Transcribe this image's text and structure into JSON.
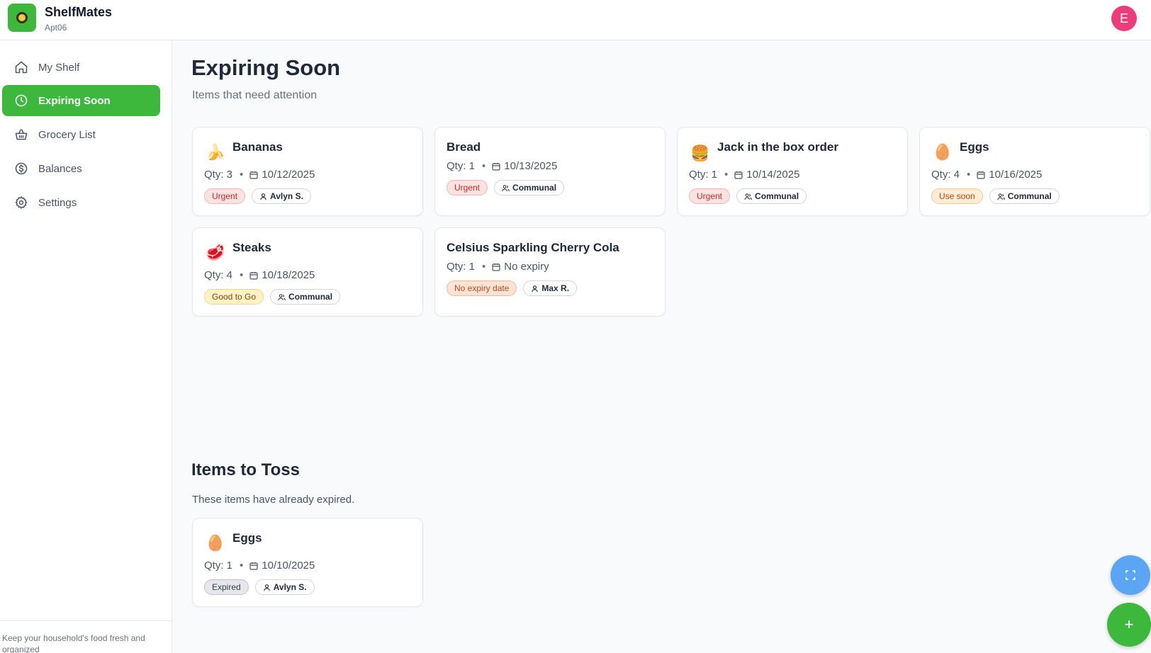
{
  "app": {
    "name": "ShelfMates",
    "household": "Apt06",
    "avatar_letter": "E",
    "avatar_color": "#ec3d7a",
    "accent": "#3db83d"
  },
  "sidebar": {
    "items": [
      {
        "label": "My Shelf",
        "icon": "home-icon",
        "active": false
      },
      {
        "label": "Expiring Soon",
        "icon": "clock-icon",
        "active": true
      },
      {
        "label": "Grocery List",
        "icon": "basket-icon",
        "active": false
      },
      {
        "label": "Balances",
        "icon": "dollar-circle-icon",
        "active": false
      },
      {
        "label": "Settings",
        "icon": "gear-icon",
        "active": false
      }
    ],
    "footer": "Keep your household's food fresh and organized"
  },
  "main": {
    "title": "Expiring Soon",
    "subtitle": "Items that need attention",
    "cards": [
      {
        "name": "Bananas",
        "emoji": "🍌",
        "qty": "Qty: 3",
        "date": "10/12/2025",
        "status": "Urgent",
        "owner": "Avlyn S.",
        "owner_type": "person"
      },
      {
        "name": "Bread",
        "emoji": "",
        "qty": "Qty: 1",
        "date": "10/13/2025",
        "status": "Urgent",
        "owner": "Communal",
        "owner_type": "group"
      },
      {
        "name": "Jack in the box order",
        "emoji": "🍔",
        "qty": "Qty: 1",
        "date": "10/14/2025",
        "status": "Urgent",
        "owner": "Communal",
        "owner_type": "group"
      },
      {
        "name": "Eggs",
        "emoji": "🥚",
        "qty": "Qty: 4",
        "date": "10/16/2025",
        "status": "Use soon",
        "owner": "Communal",
        "owner_type": "group"
      },
      {
        "name": "Steaks",
        "emoji": "🥩",
        "qty": "Qty: 4",
        "date": "10/18/2025",
        "status": "Good to Go",
        "owner": "Communal",
        "owner_type": "group"
      },
      {
        "name": "Celsius Sparkling Cherry Cola",
        "emoji": "",
        "qty": "Qty: 1",
        "date": "No expiry",
        "status": "No expiry date",
        "owner": "Max R.",
        "owner_type": "person"
      }
    ]
  },
  "toss": {
    "title": "Items to Toss",
    "subtitle": "These items have already expired.",
    "cards": [
      {
        "name": "Eggs",
        "emoji": "🥚",
        "qty": "Qty: 1",
        "date": "10/10/2025",
        "status": "Expired",
        "owner": "Avlyn S.",
        "owner_type": "person"
      }
    ]
  },
  "fab": {
    "scan_icon": "scan-icon",
    "add_label": "+"
  }
}
